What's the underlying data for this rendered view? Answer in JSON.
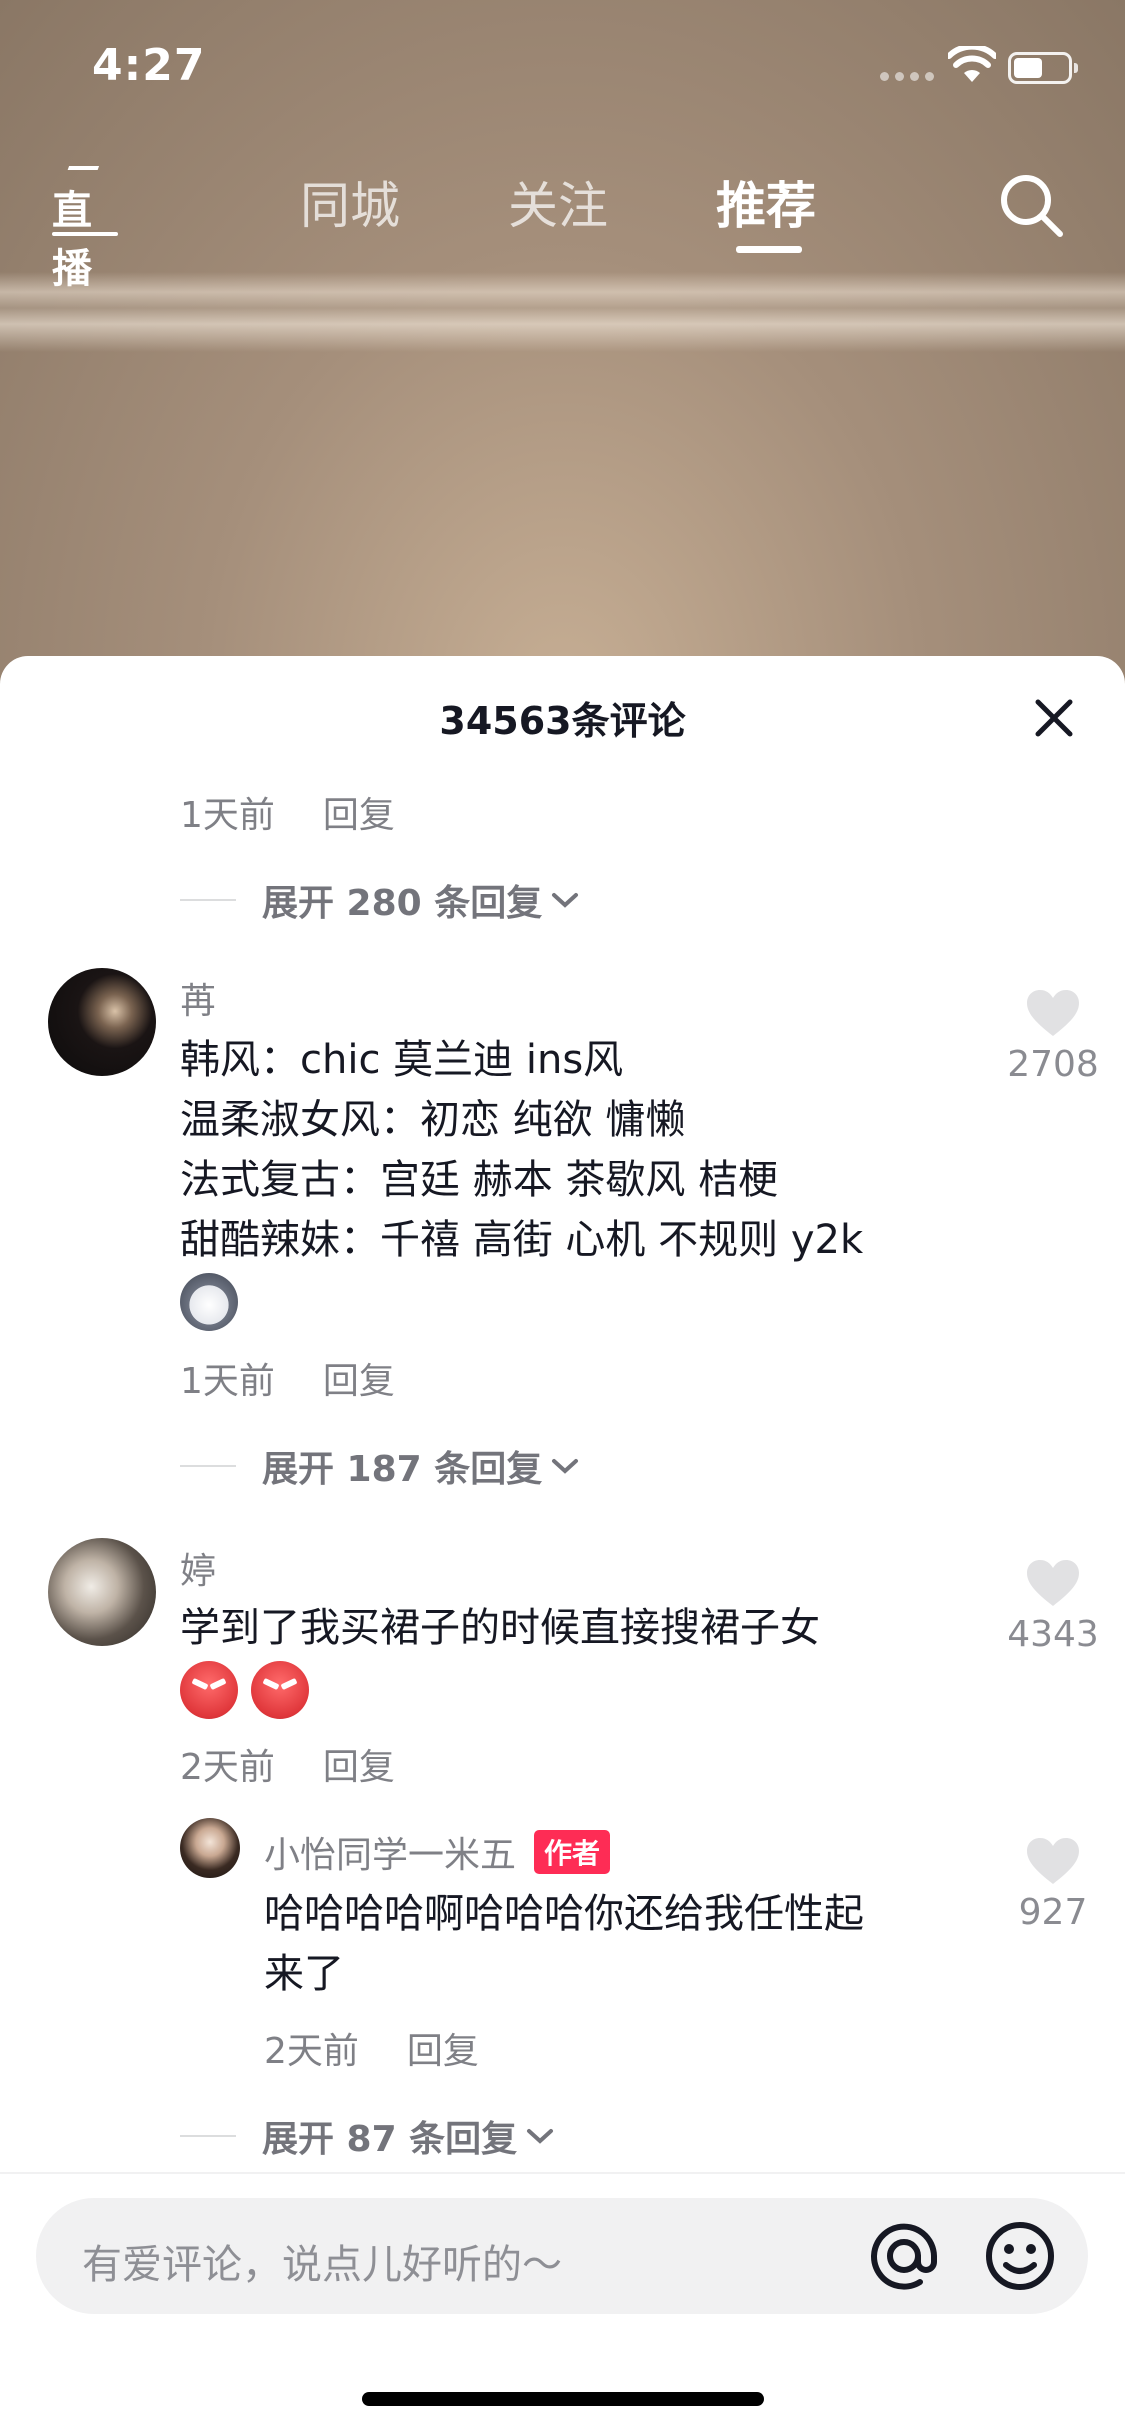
{
  "status_bar": {
    "time": "4:27"
  },
  "top_nav": {
    "live_label": "直播",
    "tabs": [
      {
        "label": "同城",
        "active": false
      },
      {
        "label": "关注",
        "active": false
      },
      {
        "label": "推荐",
        "active": true
      }
    ]
  },
  "sheet": {
    "title": "34563条评论",
    "comments": [
      {
        "meta": {
          "time": "1天前",
          "reply": "回复"
        },
        "expand": "展开 280 条回复"
      },
      {
        "username": "苒",
        "lines": [
          "韩风：chic 莫兰迪 ins风",
          "温柔淑女风：初恋 纯欲 慵懒",
          "法式复古：宫廷 赫本 茶歇风 桔梗",
          "甜酷辣妹：千禧 高街 心机 不规则 y2k"
        ],
        "emojis": [
          "husky-emoji"
        ],
        "likes": "2708",
        "meta": {
          "time": "1天前",
          "reply": "回复"
        },
        "expand": "展开 187 条回复"
      },
      {
        "username": "婷",
        "lines": [
          "学到了我买裙子的时候直接搜裙子女"
        ],
        "emojis": [
          "angry-emoji",
          "angry-emoji"
        ],
        "likes": "4343",
        "meta": {
          "time": "2天前",
          "reply": "回复"
        },
        "reply": {
          "username": "小怡同学一米五",
          "badge": "作者",
          "lines": [
            "哈哈哈哈啊哈哈哈你还给我任性起",
            "来了"
          ],
          "likes": "927",
          "meta": {
            "time": "2天前",
            "reply": "回复"
          }
        },
        "expand": "展开 87 条回复"
      }
    ]
  },
  "input": {
    "placeholder": "有爱评论，说点儿好听的～"
  },
  "colors": {
    "accent": "#fe2c55",
    "text": "#161823",
    "muted": "#8a8b91"
  }
}
